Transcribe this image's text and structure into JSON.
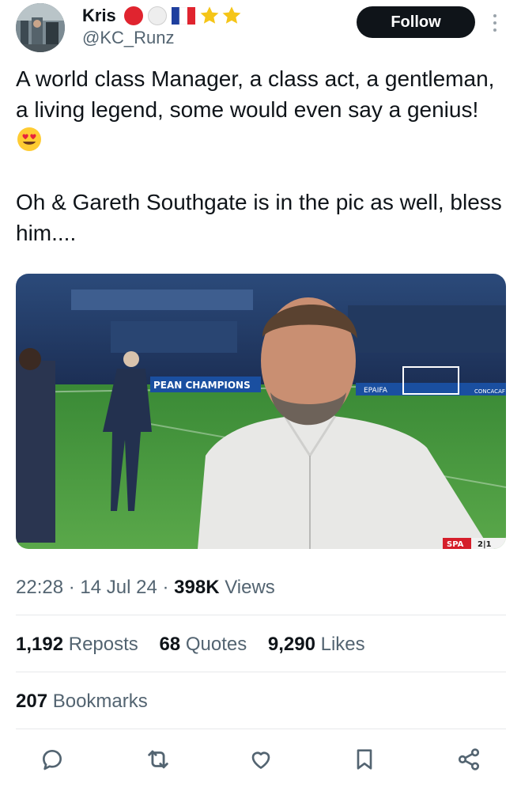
{
  "author": {
    "name": "Kris",
    "handle": "@KC_Runz",
    "name_emojis": [
      "red-circle",
      "white-circle",
      "france-flag",
      "star",
      "star"
    ]
  },
  "follow_label": "Follow",
  "tweet": {
    "paragraph1": "A world class Manager, a class act, a gentleman, a living legend, some would even say a genius!",
    "paragraph1_emoji": "heart-eyes-emoji",
    "paragraph2": "Oh & Gareth Southgate is in the pic as well, bless him...."
  },
  "media": {
    "board_text": "PEAN CHAMPIONS",
    "board_text_right": "CONCACAF",
    "board_text_mid": "EPAIFA",
    "scorebug_team": "SPA",
    "scorebug_score": "2|1"
  },
  "meta": {
    "time": "22:28",
    "date": "14 Jul 24",
    "views_count": "398K",
    "views_label": "Views"
  },
  "stats": {
    "reposts_count": "1,192",
    "reposts_label": "Reposts",
    "quotes_count": "68",
    "quotes_label": "Quotes",
    "likes_count": "9,290",
    "likes_label": "Likes",
    "bookmarks_count": "207",
    "bookmarks_label": "Bookmarks"
  },
  "actions": [
    "reply-icon",
    "repost-icon",
    "like-icon",
    "bookmark-icon",
    "share-icon"
  ],
  "colors": {
    "text": "#0f1419",
    "secondary": "#536471",
    "divider": "#e7e9ea",
    "follow_bg": "#0f1419",
    "pitch": "#3f8f3a",
    "board": "#1a4fa0"
  }
}
